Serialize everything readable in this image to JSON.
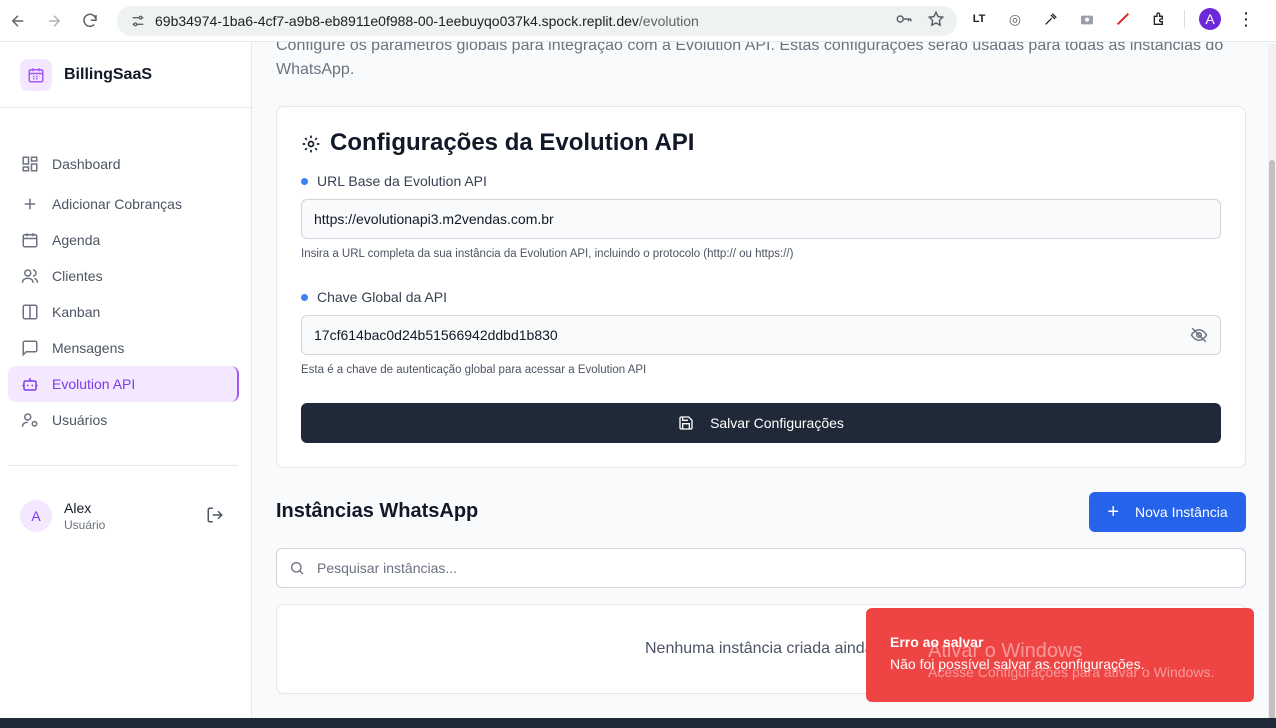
{
  "browser": {
    "url_host": "69b34974-1ba6-4cf7-a9b8-eb8911e0f988-00-1eebuyqo037k4.spock.replit.dev",
    "url_path": "/evolution",
    "profile_initial": "A"
  },
  "sidebar": {
    "brand": "BillingSaaS",
    "items": [
      {
        "label": "Dashboard",
        "icon": "dashboard-icon"
      },
      {
        "label": "Adicionar Cobranças",
        "icon": "plus-icon"
      },
      {
        "label": "Agenda",
        "icon": "calendar-icon"
      },
      {
        "label": "Clientes",
        "icon": "users-icon"
      },
      {
        "label": "Kanban",
        "icon": "kanban-icon"
      },
      {
        "label": "Mensagens",
        "icon": "message-icon"
      },
      {
        "label": "Evolution API",
        "icon": "bot-icon",
        "active": true
      },
      {
        "label": "Usuários",
        "icon": "user-cog-icon"
      }
    ],
    "user": {
      "initial": "A",
      "name": "Alex",
      "role": "Usuário"
    }
  },
  "main": {
    "intro": "Configure os parâmetros globais para integração com a Evolution API. Estas configurações serão usadas para todas as instâncias do WhatsApp.",
    "config_card": {
      "title": "Configurações da Evolution API",
      "url_label": "URL Base da Evolution API",
      "url_value": "https://evolutionapi3.m2vendas.com.br",
      "url_help": "Insira a URL completa da sua instância da Evolution API, incluindo o protocolo (http:// ou https://)",
      "key_label": "Chave Global da API",
      "key_value": "17cf614bac0d24b51566942ddbd1b830",
      "key_help": "Esta é a chave de autenticação global para acessar a Evolution API",
      "save_label": "Salvar Configurações"
    },
    "instances": {
      "title": "Instâncias WhatsApp",
      "new_label": "Nova Instância",
      "search_placeholder": "Pesquisar instâncias...",
      "empty_text": "Nenhuma instância criada ainda"
    }
  },
  "toast": {
    "title": "Erro ao salvar",
    "message": "Não foi possível salvar as configurações."
  },
  "watermark": {
    "title": "Ativar o Windows",
    "subtitle": "Acesse Configurações para ativar o Windows."
  },
  "colors": {
    "accent": "#7c3aed",
    "primary_button": "#1f2937",
    "blue_button": "#2563eb",
    "error": "#ef4444"
  }
}
